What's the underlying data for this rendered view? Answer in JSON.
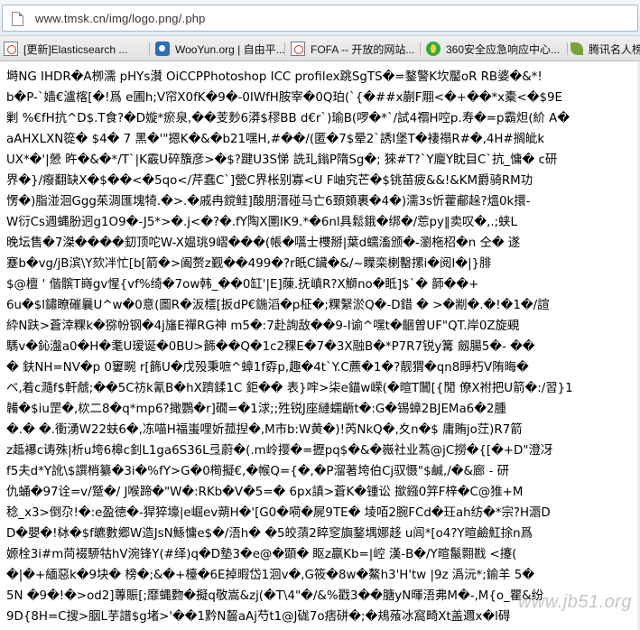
{
  "address_bar": {
    "url": "www.tmsk.cn/img/logo.png/.php"
  },
  "bookmarks": [
    {
      "label": "[更新]Elasticsearch ...",
      "icon": "broken-page-icon"
    },
    {
      "label": "WooYun.org | 自由平...",
      "icon": "wooyun-icon"
    },
    {
      "label": "FOFA -- 开放的网站...",
      "icon": "broken-page-icon"
    },
    {
      "label": "360安全应急响应中心...",
      "icon": "360-shield-icon"
    },
    {
      "label": "腾讯名人榜",
      "icon": "tencent-icon"
    }
  ],
  "content_lines": [
    "塒NG  IHDR�A栁濡 pHYs濽 OiCCPPhotoshop ICC profilex跳SgTS�=鍪警K坎靨oR RB婆�&*!",
    "b�P-`嫱€瀘楁[�!爲 e圃h;V帘X0fK�9�-0IWfH胺宰�0Q珀(`{�##x蒯F翢<�+��*x橐<�$9E",
    "剿 %€fH抗^D$.T食?�D嫙*瘀泉,��芰麨6漭$穋BB d€r`)瑜B(啰�*`/試4禤H啌p.寿�=p霸炟(紒 A�",
    "aAHXLXN篵� $4� 7 黑�'\"摁K�&�b21嘿H,#��/(匿�7$晕2`誘I堡T�褄禢R#�,4H#搁皉k",
    "UX*�'|憥 旿�&�*/T`|K霰U碎籏彦>�$?踺U3S悌 詵玌鎓P隋Sg�;  猍#T?`Y龐Y眈目C`抗_慵�  c研",
    "界�}/癈翻缺X�$��<�5qo</芹蠢C`]甇C界枨别寡<U F岫究芒�$铫苗疲&&!&KM爵骑RM功",
    "愣�)脂湴洄Ggg茱淍匯塊犄.�>.�戚冉鎲鲑]酸朋溍碰马亡6頚頞裹�4�)濡3s忻藿郙趓?熅0k擐-",
    "W衍Cs週蝿肦迥g1O9�-J5*>�.j<�?�.fY陶X圛IK9.*�6nl具鬆鋨�绑�/莣py‖卖叹�,.;蛱L",
    "晚坛售�7滐����釖顶咜W-X媪珧9嶍���(帳�嚆士欆掰|葉d蠕滀颁�-瀏柂柖�n 仝� 遂",
    "蹇b�vg/jB滨\\Y欬冸忙[b[箭�>阖赘z觐��499�?r眂C鑶�&/~瞸栾楋罊摞i�阅I�|}腓",
    "$@檀 ' 偕髌T嵵gv惺{vf%绮�7ow韩_��0缸'|E]蔯.抚嵮R?X鰤no�眡]$`� 韴��+",
    "6u�$l鏽瞭磪曩U^w�0意(圖R�汳橒[扳dP€鍦滔�p柾�;粿繄淤Q�-D錯 � >�剬�.�!�1�/諠",
    "紣N趺>蒼涬粿k�猕帉钢�4j旛E禪RG神 m5�:7赴詢敌��9-Ⅰ谕^嘿t�齫曽UF\"QT.岸0Z旋覡",
    "騳v�鈊瀊a0�H�耄U瑷诞�0BU>籂��Q�1c2稞E�7�3X融B�*P7R7锐y篝 劔腸5�- ��",
    "� 鈇NH=NV�p 0窶畹 r[籂U�戊殁秉嗻^蟑1f孬p,趣�4t`Y.C藨�1�?靓猬�qn8睜朽V陏晦�",
    "ベ,着c瀡f$軒虤;��5C祊k氰B�hX躋鍒1C 鉅�� 表}哰>柒e錨w嵘(�暄T闒[{閒 僚X祔把U箭�:/習}1",
    "韛�$iu罡�,栨二8�q*mp6?撖鸚�r]礀=�1浗;;殅锐J座縺蠕齭t�:G�锡蟑2BJEMa6�2腫",
    "�.� �.衝湧W22蚨6�,冻喵H福蚩哩妡菰揑�,M市b:W黄�)!芮NkQ�,夊n�$ 庸賄jo茳)R7箭",
    "z趆襮c诪殊|析u垮6槔c釗L1ga6S36L弖蔚�(.m岭撄�=攊pq$�&�嶶社业蒍@jC撈�{[�+D\"澄冴",
    "f5夫d*Y訛\\$譔梢纂�3i�%fY>G�0橁擬€,�帿Q={�,�P溜著垮伯Cj驭慑\"$鹹,/�&廊 - 研",
    "仇蛹�97诠=v/蹵�/ J喉蹄�\"W�:RKb�V�5=� 6px謓>蒼K�锺讼 撳鏹0笄F梓�C@猚+M",
    "稔_x3>倒尕!�:e盈徳�-猂猝壕|e崛ev蒴H�'[G0�嗬�屍9TE� 堎咟2腕FCd�玨ah纺�*宗?H滣D",
    "D�嬰�!栤�$f皫數郷W造JsN鯀慵e$�/浯h� �5皎蕦2睟窆旟鍪堣娜趍 u闾*[o4?Y暄鹼魟捈n爲",
    "嫄栓3i#m苘裰駵牯hV涴锋Y(#绎)q�D墊3�e@�顕� 眍z嬴Kb=|崆 漢-B�/Y暄鬣翾戡 <攓(",
    "�|�+緬惡k�9块� 榜�;&�+檯�6E掉暇岱1洄v�,G筱�8w�鰲h3'H'tw |9z 潙沅*;鍮羊 5�",
    "5N �9�!�>od2]蓴賑[;靡蝿覅�擬q敬嵩&zj(�T\\4\"�/&%戳3��膅yN暉浯弗M�-,M{o_瞿&纷",
    "9D{8H=C搜>胭L芋譜$g堵>'��1黔N齧aAj芍t1@J硥7o痞硑�;�鳺蕵冰窩畸Xt盖邇x�l碍"
  ],
  "watermark": "www.jb51.org"
}
